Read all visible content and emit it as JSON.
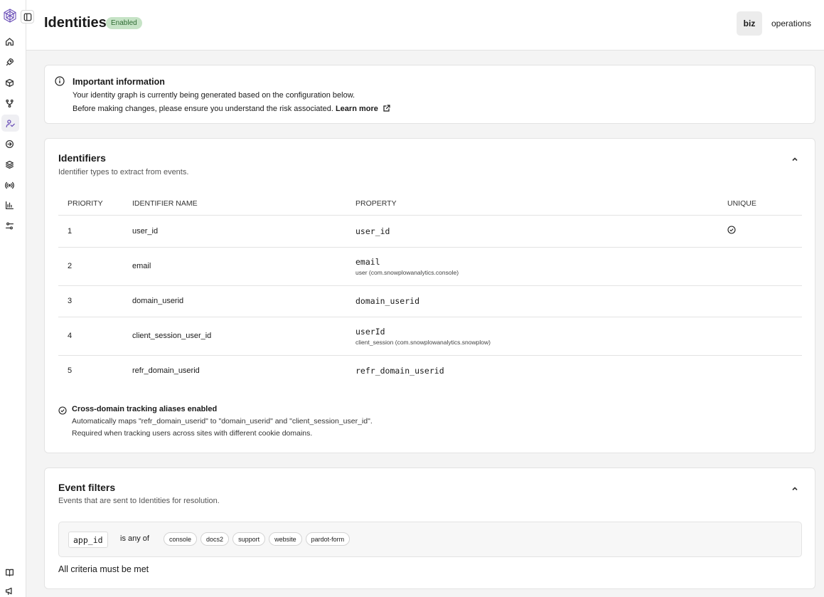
{
  "header": {
    "title": "Identities",
    "status_badge": "Enabled",
    "pipelines": [
      "biz",
      "operations"
    ]
  },
  "sidebar": {
    "items": [
      "home-icon",
      "rocket-icon",
      "box-icon",
      "pipeline-icon",
      "identities-icon",
      "arrow-circle-icon",
      "layers-icon",
      "broadcast-icon",
      "chart-icon",
      "settings-sliders-icon"
    ],
    "bottom_items": [
      "docs-book-icon",
      "announcement-icon"
    ],
    "active": "identities-icon"
  },
  "info": {
    "heading": "Important information",
    "line1": "Your identity graph is currently being generated based on the configuration below.",
    "line2": "Before making changes, please ensure you understand the risk associated.",
    "link": "Learn more"
  },
  "identifiers": {
    "title": "Identifiers",
    "subtitle": "Identifier types to extract from events.",
    "columns": [
      "PRIORITY",
      "IDENTIFIER NAME",
      "PROPERTY",
      "UNIQUE"
    ],
    "rows": [
      {
        "priority": "1",
        "name": "user_id",
        "property": "user_id",
        "source": "",
        "unique": true
      },
      {
        "priority": "2",
        "name": "email",
        "property": "email",
        "source": "user (com.snowplowanalytics.console)",
        "unique": false
      },
      {
        "priority": "3",
        "name": "domain_userid",
        "property": "domain_userid",
        "source": "",
        "unique": false
      },
      {
        "priority": "4",
        "name": "client_session_user_id",
        "property": "userId",
        "source": "client_session (com.snowplowanalytics.snowplow)",
        "unique": false
      },
      {
        "priority": "5",
        "name": "refr_domain_userid",
        "property": "refr_domain_userid",
        "source": "",
        "unique": false
      }
    ],
    "alias": {
      "heading": "Cross-domain tracking aliases enabled",
      "line1": "Automatically maps \"refr_domain_userid\" to \"domain_userid\" and \"client_session_user_id\".",
      "line2": "Required when tracking users across sites with different cookie domains."
    }
  },
  "filters": {
    "title": "Event filters",
    "subtitle": "Events that are sent to Identities for resolution.",
    "field": "app_id",
    "operator": "is any of",
    "values": [
      "console",
      "docs2",
      "support",
      "website",
      "pardot-form"
    ],
    "criteria": "All criteria must be met"
  },
  "colors": {
    "badge_bg": "#c6e3c6",
    "badge_text": "#2e6b33",
    "accent": "#6b4fb8"
  }
}
